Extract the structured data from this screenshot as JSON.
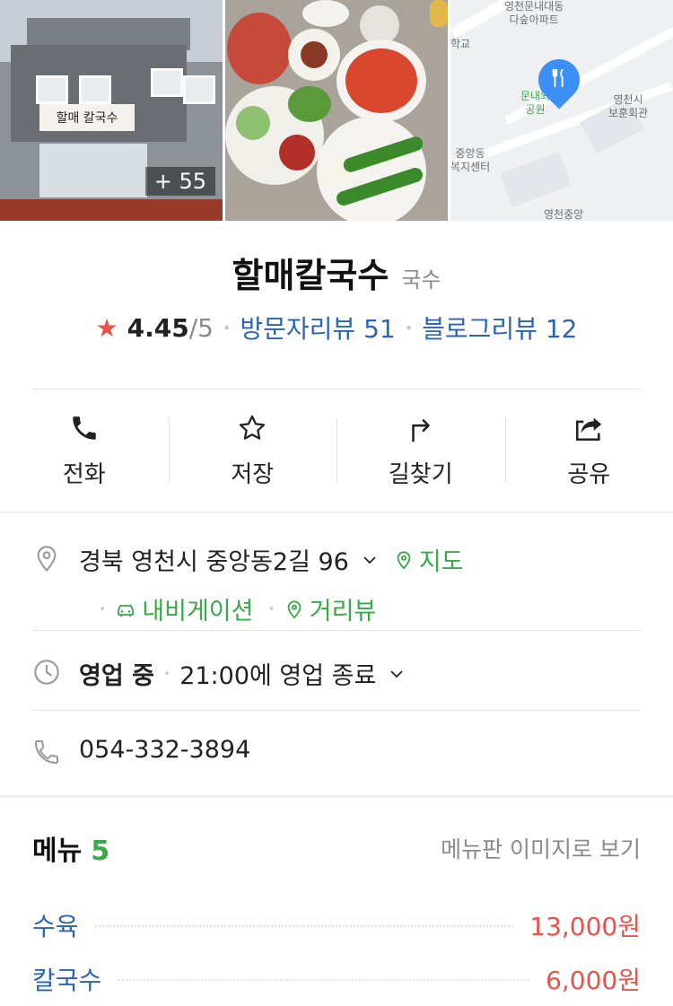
{
  "photos": {
    "building_sign": "할매 칼국수",
    "more_count": "+ 55",
    "map_labels": [
      "영천문내대동\n다숲아파트",
      "학교",
      "문내외\n공원",
      "영천시\n보훈회관",
      "중앙동\n복지센터",
      "영천중앙"
    ]
  },
  "place": {
    "name": "할매칼국수",
    "category": "국수",
    "rating": "4.45",
    "rating_max": "/5",
    "visitor_reviews": "방문자리뷰 51",
    "blog_reviews": "블로그리뷰 12"
  },
  "actions": [
    {
      "label": "전화",
      "icon": "phone-icon"
    },
    {
      "label": "저장",
      "icon": "star-icon"
    },
    {
      "label": "길찾기",
      "icon": "directions-icon"
    },
    {
      "label": "공유",
      "icon": "share-icon"
    }
  ],
  "info": {
    "address": "경북 영천시 중앙동2길 96",
    "map_link": "지도",
    "navigation_link": "내비게이션",
    "street_view_link": "거리뷰",
    "status": "영업 중",
    "closing": "21:00에 영업 종료",
    "phone": "054-332-3894"
  },
  "menu": {
    "title": "메뉴",
    "count": "5",
    "board_link": "메뉴판 이미지로 보기",
    "items": [
      {
        "name": "수육",
        "price": "13,000원"
      },
      {
        "name": "칼국수",
        "price": "6,000원"
      }
    ]
  },
  "colors": {
    "accent_green": "#3aa94a",
    "link_blue": "#2c64b5",
    "price_red": "#e8524a"
  }
}
